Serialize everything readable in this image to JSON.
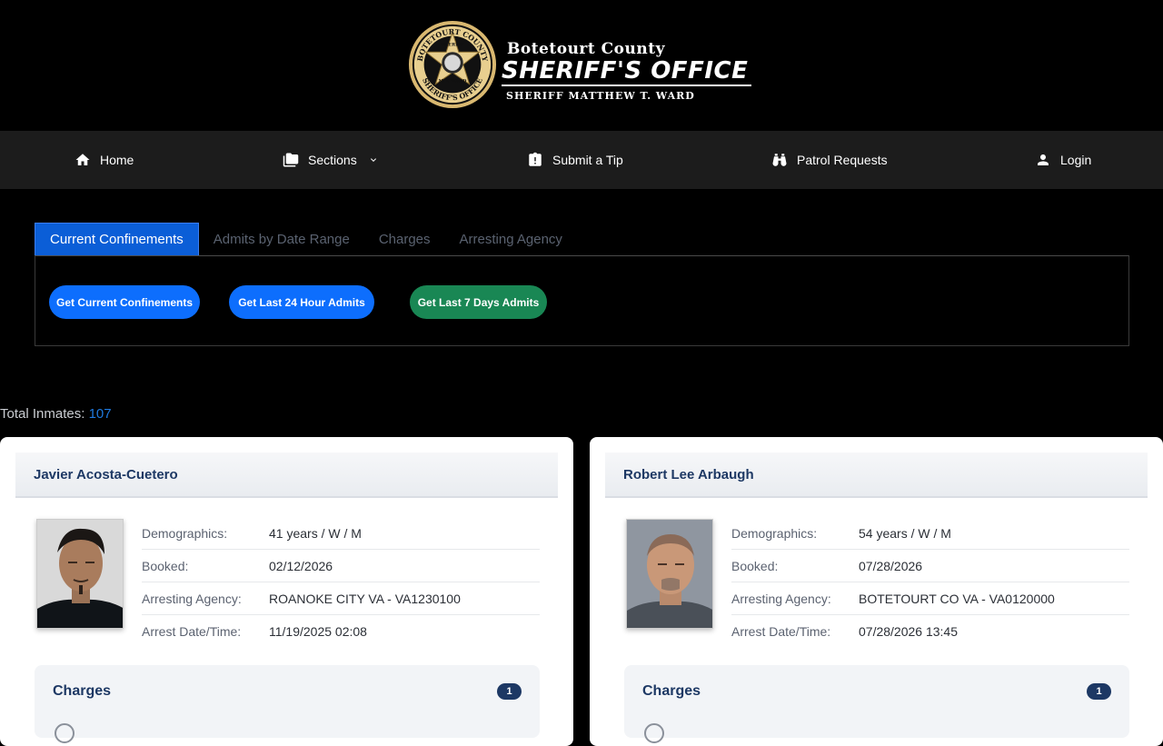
{
  "header": {
    "badge_top_text": "BOTETOURT COUNTY",
    "badge_inner_text": "SHERIFF",
    "badge_name": "M.T. WARD",
    "badge_bottom_text": "SHERIFF'S OFFICE",
    "county": "Botetourt County",
    "office": "SHERIFF'S OFFICE",
    "sheriff": "SHERIFF MATTHEW T. WARD"
  },
  "nav": {
    "home": "Home",
    "sections": "Sections",
    "tip": "Submit a Tip",
    "patrol": "Patrol Requests",
    "login": "Login"
  },
  "tabs": [
    "Current Confinements",
    "Admits by Date Range",
    "Charges",
    "Arresting Agency"
  ],
  "buttons": {
    "current": "Get Current Confinements",
    "last24": "Get Last 24 Hour Admits",
    "last7": "Get Last 7 Days Admits"
  },
  "total": {
    "label": "Total Inmates:",
    "count": "107"
  },
  "labels": {
    "demographics": "Demographics:",
    "booked": "Booked:",
    "agency": "Arresting Agency:",
    "arrest": "Arrest Date/Time:",
    "charges": "Charges"
  },
  "inmates": [
    {
      "name": "Javier Acosta-Cuetero",
      "demographics": "41 years / W / M",
      "booked": "02/12/2026",
      "agency": "ROANOKE CITY VA - VA1230100",
      "arrest": "11/19/2025 02:08",
      "charges_count": "1"
    },
    {
      "name": "Robert Lee Arbaugh",
      "demographics": "54 years / W / M",
      "booked": "07/28/2026",
      "agency": "BOTETOURT CO VA - VA0120000",
      "arrest": "07/28/2026 13:45",
      "charges_count": "1"
    }
  ],
  "colors": {
    "primary": "#0d6efd",
    "success": "#198754",
    "navy": "#1d3864",
    "nav_bg": "#1c1c1c"
  }
}
